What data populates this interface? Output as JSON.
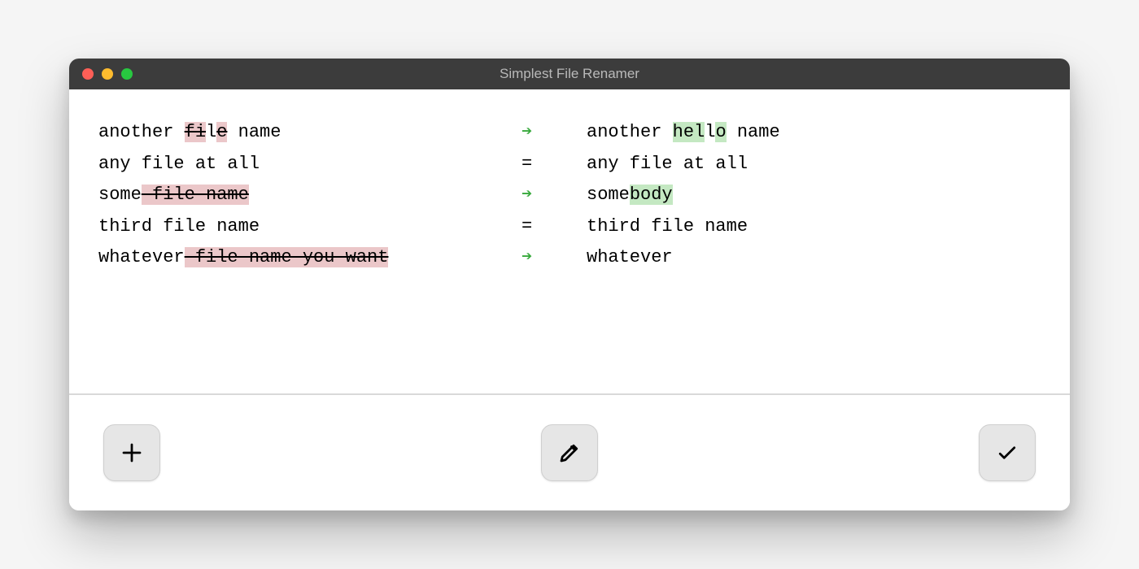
{
  "window": {
    "title": "Simplest File Renamer"
  },
  "rows": [
    {
      "changed": true,
      "old_segments": [
        {
          "text": "another ",
          "kind": "same"
        },
        {
          "text": "fi",
          "kind": "del"
        },
        {
          "text": "l",
          "kind": "same"
        },
        {
          "text": "e",
          "kind": "del"
        },
        {
          "text": " name",
          "kind": "same"
        }
      ],
      "new_segments": [
        {
          "text": "another ",
          "kind": "same"
        },
        {
          "text": "hel",
          "kind": "ins"
        },
        {
          "text": "l",
          "kind": "same"
        },
        {
          "text": "o",
          "kind": "ins"
        },
        {
          "text": " name",
          "kind": "same"
        }
      ]
    },
    {
      "changed": false,
      "old_segments": [
        {
          "text": "any file at all",
          "kind": "same"
        }
      ],
      "new_segments": [
        {
          "text": "any file at all",
          "kind": "same"
        }
      ]
    },
    {
      "changed": true,
      "old_segments": [
        {
          "text": "some",
          "kind": "same"
        },
        {
          "text": " file name",
          "kind": "del"
        }
      ],
      "new_segments": [
        {
          "text": "some",
          "kind": "same"
        },
        {
          "text": "body",
          "kind": "ins"
        }
      ]
    },
    {
      "changed": false,
      "old_segments": [
        {
          "text": "third file name",
          "kind": "same"
        }
      ],
      "new_segments": [
        {
          "text": "third file name",
          "kind": "same"
        }
      ]
    },
    {
      "changed": true,
      "old_segments": [
        {
          "text": "whatever",
          "kind": "same"
        },
        {
          "text": " file name you want",
          "kind": "del"
        }
      ],
      "new_segments": [
        {
          "text": "whatever",
          "kind": "same"
        }
      ]
    }
  ],
  "separators": {
    "changed": "➔",
    "unchanged": "="
  },
  "toolbar": {
    "add_label": "Add files",
    "edit_label": "Edit rules",
    "apply_label": "Apply rename"
  },
  "icons": {
    "plus": "plus-icon",
    "pencil": "pencil-icon",
    "check": "check-icon"
  },
  "colors": {
    "titlebar_bg": "#3c3c3c",
    "titlebar_text": "#b9b9b9",
    "arrow": "#37a93c",
    "del_bg": "#ebc7c9",
    "ins_bg": "#c4e8c2",
    "btn_bg": "#e6e6e6"
  }
}
